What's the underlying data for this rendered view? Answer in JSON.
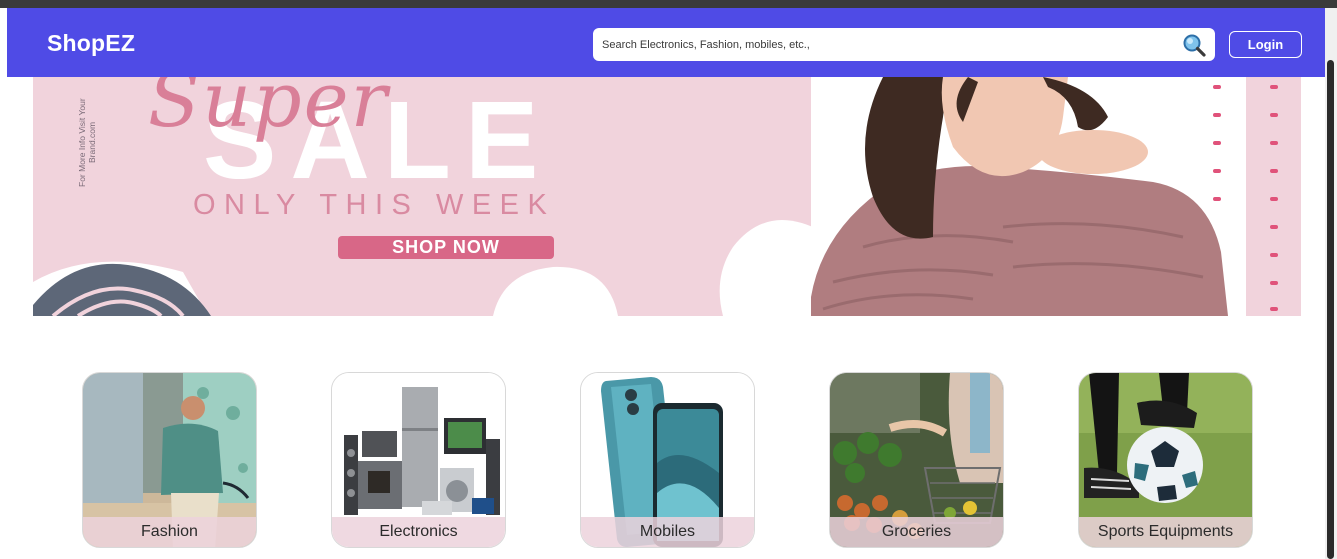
{
  "header": {
    "brand": "ShopEZ",
    "search_placeholder": "Search Electronics, Fashion, mobiles, etc.,",
    "login_label": "Login",
    "accent_color": "#4f4be6"
  },
  "banner": {
    "side_text": "For More Info Visit Your Brand.com",
    "script_word": "Super",
    "headline": "SALE",
    "tagline": "ONLY THIS WEEK",
    "cta_label": "SHOP NOW"
  },
  "categories": [
    {
      "label": "Fashion"
    },
    {
      "label": "Electronics"
    },
    {
      "label": "Mobiles"
    },
    {
      "label": "Groceries"
    },
    {
      "label": "Sports Equipments"
    }
  ]
}
